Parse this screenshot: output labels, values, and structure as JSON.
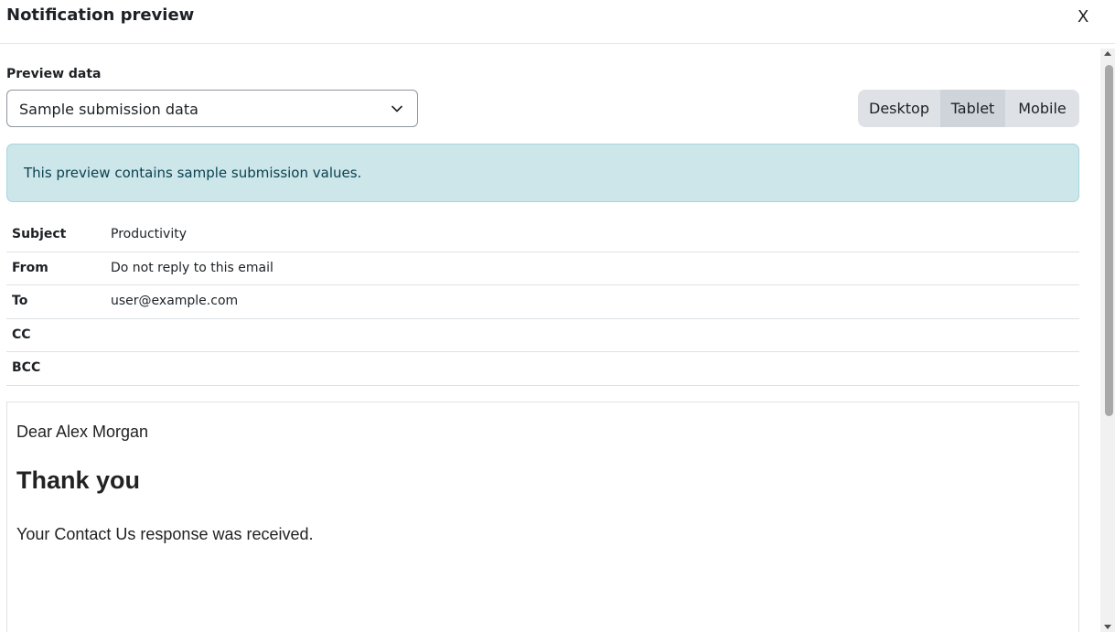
{
  "dialog": {
    "title": "Notification preview",
    "close_label": "X"
  },
  "preview": {
    "label": "Preview data",
    "selected": "Sample submission data"
  },
  "views": {
    "options": [
      "Desktop",
      "Tablet",
      "Mobile"
    ],
    "active": "Tablet"
  },
  "alert": {
    "text": "This preview contains sample submission values."
  },
  "meta": [
    {
      "key": "Subject",
      "value": "Productivity"
    },
    {
      "key": "From",
      "value": "Do not reply to this email"
    },
    {
      "key": "To",
      "value": "user@example.com"
    },
    {
      "key": "CC",
      "value": ""
    },
    {
      "key": "BCC",
      "value": ""
    }
  ],
  "email": {
    "greeting": "Dear Alex Morgan",
    "heading": "Thank you",
    "body": "Your Contact Us response was received."
  },
  "colors": {
    "alert_bg": "#cce6ea",
    "alert_text": "#0b4150",
    "active_view_bg": "#ced4da"
  }
}
